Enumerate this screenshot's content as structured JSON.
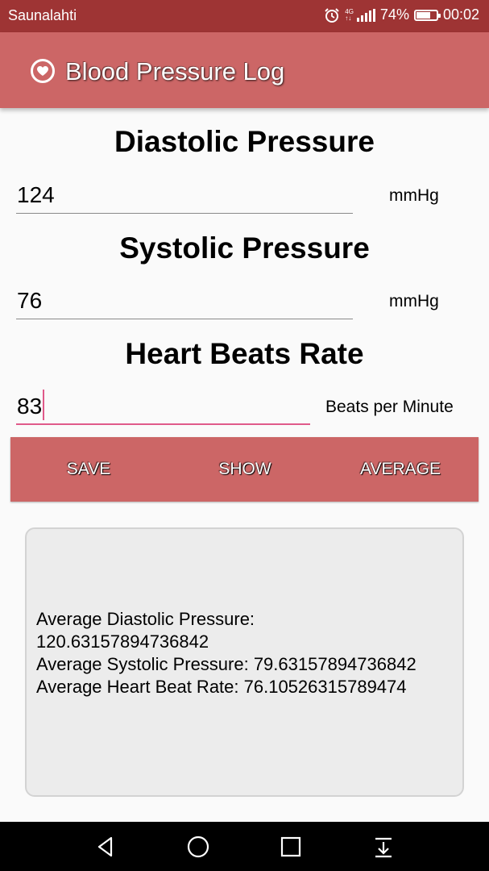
{
  "status_bar": {
    "carrier": "Saunalahti",
    "network": "4G",
    "battery_percent_text": "74%",
    "battery_level": 0.74,
    "time": "00:02"
  },
  "app_bar": {
    "title": "Blood Pressure Log",
    "icon": "heart-icon"
  },
  "form": {
    "diastolic": {
      "heading": "Diastolic Pressure",
      "value": "124",
      "unit": "mmHg"
    },
    "systolic": {
      "heading": "Systolic Pressure",
      "value": "76",
      "unit": "mmHg"
    },
    "heart_rate": {
      "heading": "Heart Beats Rate",
      "value": "83",
      "unit": "Beats per Minute"
    }
  },
  "buttons": {
    "save": "SAVE",
    "show": "SHOW",
    "average": "AVERAGE"
  },
  "result": {
    "line1": "Average Diastolic Pressure:",
    "line2": "120.63157894736842",
    "line3": "Average Systolic Pressure: 79.63157894736842",
    "line4": "Average Heart Beat Rate: 76.10526315789474"
  },
  "nav_bar": {
    "icons": [
      "back-icon",
      "home-icon",
      "recents-icon",
      "notification-pull-icon"
    ]
  },
  "colors": {
    "status_bar": "#9e3434",
    "app_bar": "#cc6666",
    "accent": "#e05a8a",
    "result_bg": "#ececec"
  }
}
